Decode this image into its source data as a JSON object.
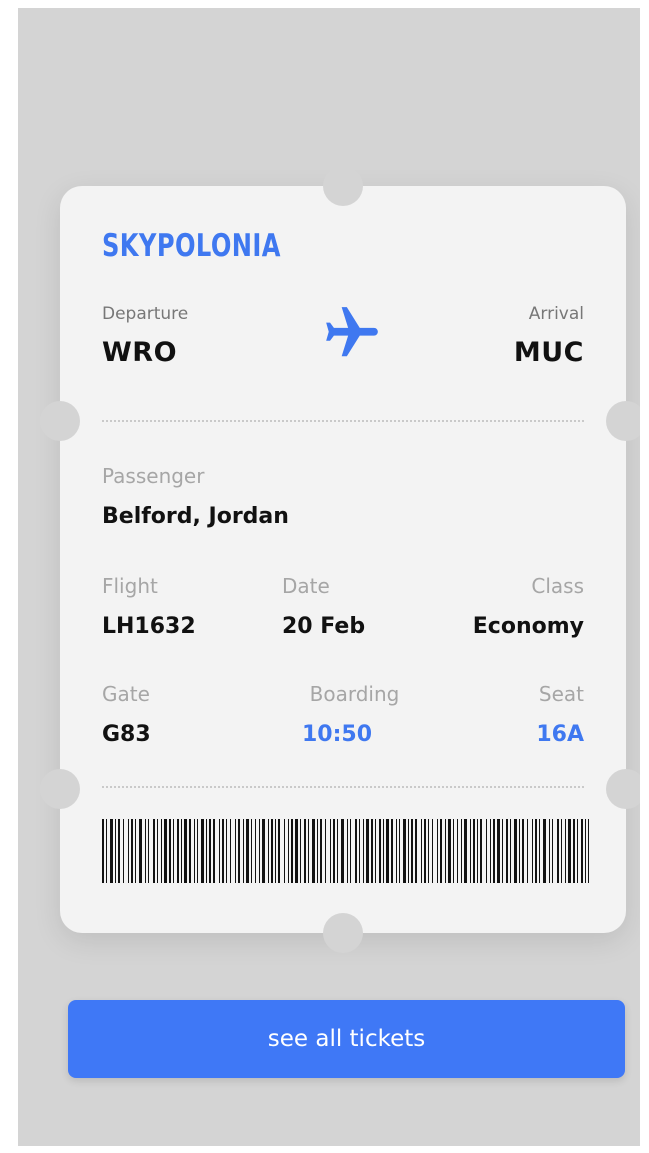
{
  "ticket": {
    "airline": "SKYPOLONIA",
    "departure": {
      "label": "Departure",
      "code": "WRO"
    },
    "arrival": {
      "label": "Arrival",
      "code": "MUC"
    },
    "passenger": {
      "label": "Passenger",
      "value": "Belford, Jordan"
    },
    "flight": {
      "label": "Flight",
      "value": "LH1632"
    },
    "date": {
      "label": "Date",
      "value": "20 Feb"
    },
    "class": {
      "label": "Class",
      "value": "Economy"
    },
    "gate": {
      "label": "Gate",
      "value": "G83"
    },
    "boarding": {
      "label": "Boarding",
      "value": "10:50"
    },
    "seat": {
      "label": "Seat",
      "value": "16A"
    }
  },
  "icons": {
    "route": "airplane-icon",
    "code": "barcode"
  },
  "colors": {
    "accent": "#3f78f0",
    "background": "#d4d4d4",
    "card": "#f3f3f3",
    "text": "#111111",
    "muted": "#a6a6a6"
  },
  "actions": {
    "see_all_label": "see all tickets"
  }
}
